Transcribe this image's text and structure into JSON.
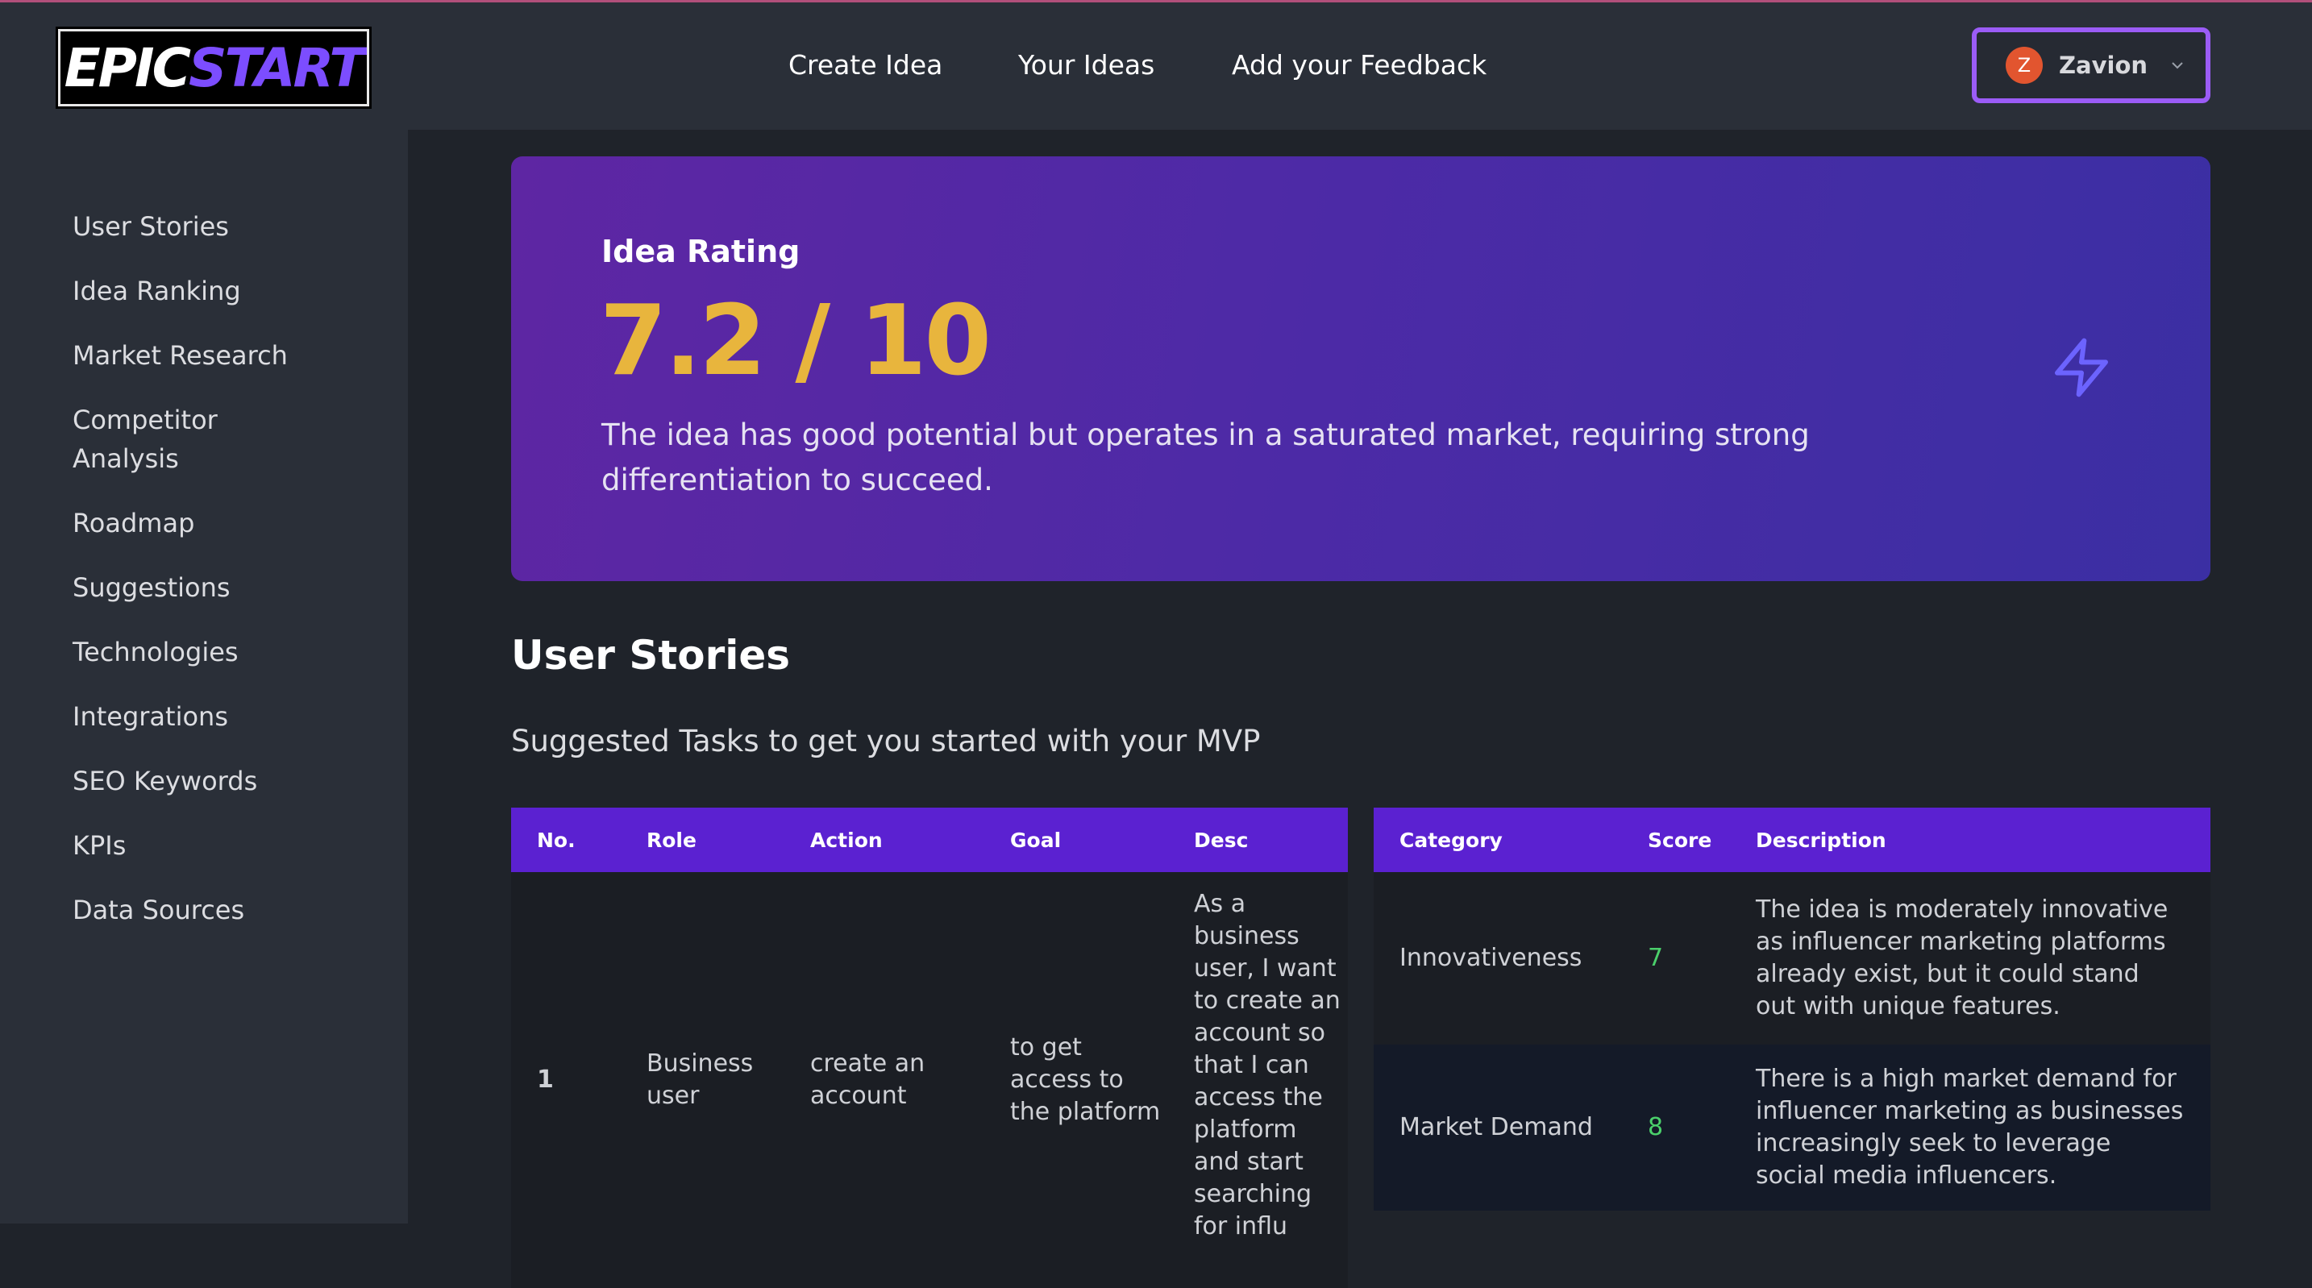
{
  "header": {
    "logo": {
      "part1": "EPIC",
      "part2": "START"
    },
    "nav": [
      "Create Idea",
      "Your Ideas",
      "Add your Feedback"
    ],
    "user": {
      "initial": "Z",
      "name": "Zavion",
      "icon": "chevron-down-icon"
    }
  },
  "sidebar": {
    "items": [
      "User Stories",
      "Idea Ranking",
      "Market Research",
      "Competitor Analysis",
      "Roadmap",
      "Suggestions",
      "Technologies",
      "Integrations",
      "SEO Keywords",
      "KPIs",
      "Data Sources"
    ]
  },
  "rating": {
    "label": "Idea Rating",
    "value": "7.2 / 10",
    "description": "The idea has good potential but operates in a saturated market, requiring strong differentiation to succeed.",
    "icon": "lightning-bolt-icon",
    "icon_color": "#6c63ff"
  },
  "user_stories": {
    "title": "User Stories",
    "subtitle": "Suggested Tasks to get you started with your MVP",
    "columns": [
      "No.",
      "Role",
      "Action",
      "Goal",
      "Desc"
    ],
    "rows": [
      {
        "no": "1",
        "role": "Business user",
        "action": "create an account",
        "goal": "to get access to the platform",
        "desc": "As a business user, I want to create an account so that I can access the platform and start searching for influ"
      }
    ]
  },
  "scores": {
    "columns": [
      "Category",
      "Score",
      "Description"
    ],
    "rows": [
      {
        "category": "Innovativeness",
        "score": "7",
        "description": "The idea is moderately innovative as influencer marketing platforms already exist, but it could stand out with unique features."
      },
      {
        "category": "Market Demand",
        "score": "8",
        "description": "There is a high market demand for influencer marketing as businesses increasingly seek to leverage social media influencers."
      }
    ]
  },
  "colors": {
    "accent": "#5b21d1",
    "rating_value": "#e8b53d",
    "score_green": "#4bd06b",
    "user_border": "#9b5cf6"
  }
}
